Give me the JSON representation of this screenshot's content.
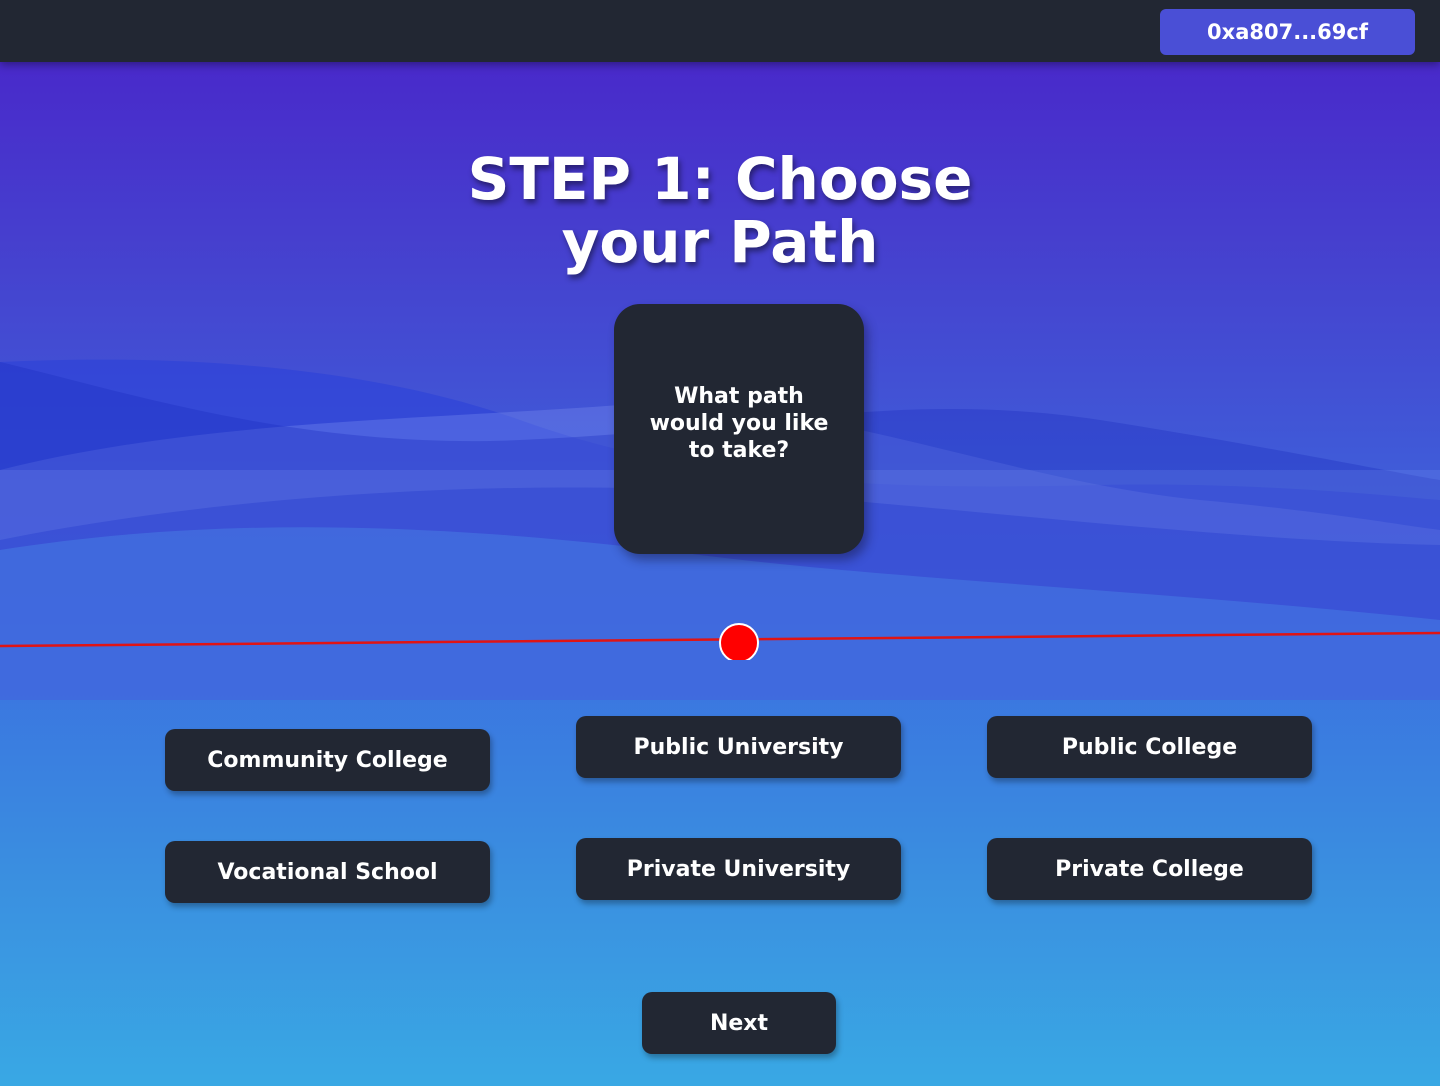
{
  "header": {
    "wallet_label": "0xa807...69cf"
  },
  "title": {
    "line1": "STEP 1: Choose",
    "line2": "your Path"
  },
  "question": {
    "text": "What path would you like to take?"
  },
  "choices": [
    {
      "label": "Community College"
    },
    {
      "label": "Public University"
    },
    {
      "label": "Public College"
    },
    {
      "label": "Vocational School"
    },
    {
      "label": "Private University"
    },
    {
      "label": "Private College"
    }
  ],
  "footer": {
    "next_label": "Next"
  },
  "colors": {
    "accent": "#4a4fd6",
    "panel": "#222733",
    "marker": "#ff0000"
  }
}
